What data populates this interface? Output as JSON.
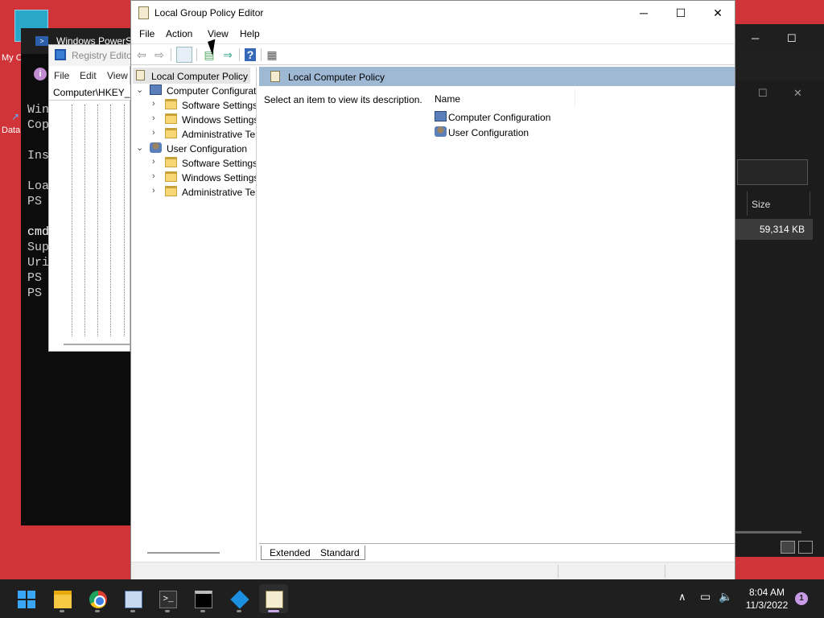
{
  "desktop": {
    "recycle_label": "My C",
    "data_label": "Data"
  },
  "powershell": {
    "title": "Windows PowerShell",
    "lines": [
      "Win",
      "Cop",
      "",
      "Ins",
      "",
      "Loa",
      "PS",
      "",
      "cmd",
      "Sup",
      "Uri",
      "PS",
      "PS"
    ]
  },
  "regedit": {
    "title": "Registry Editor",
    "menu": [
      "File",
      "Edit",
      "View"
    ],
    "address": "Computer\\HKEY_C"
  },
  "taskmgr": {
    "col_size": "Size",
    "row_value": "59,314 KB"
  },
  "gpedit": {
    "title": "Local Group Policy Editor",
    "menu": [
      "File",
      "Action",
      "View",
      "Help"
    ],
    "tree": {
      "root": "Local Computer Policy",
      "computer": "Computer Configuration",
      "computer_children": [
        "Software Settings",
        "Windows Settings",
        "Administrative Templates"
      ],
      "user": "User Configuration",
      "user_children": [
        "Software Settings",
        "Windows Settings",
        "Administrative Templates"
      ]
    },
    "detail": {
      "header": "Local Computer Policy",
      "description": "Select an item to view its description.",
      "column_name": "Name",
      "items": [
        "Computer Configuration",
        "User Configuration"
      ]
    },
    "tabs": [
      "Extended",
      "Standard"
    ]
  },
  "taskbar": {
    "time": "8:04 AM",
    "date": "11/3/2022",
    "notification_count": "1"
  },
  "icons": {
    "minimize": "─",
    "maximize": "☐",
    "close": "✕",
    "back": "⇦",
    "forward": "⇨",
    "help": "?",
    "chevron_down": "⌄",
    "chevron_right": "›",
    "up_caret": "∧",
    "network": "▭",
    "volume": "🔈",
    "info": "i"
  }
}
